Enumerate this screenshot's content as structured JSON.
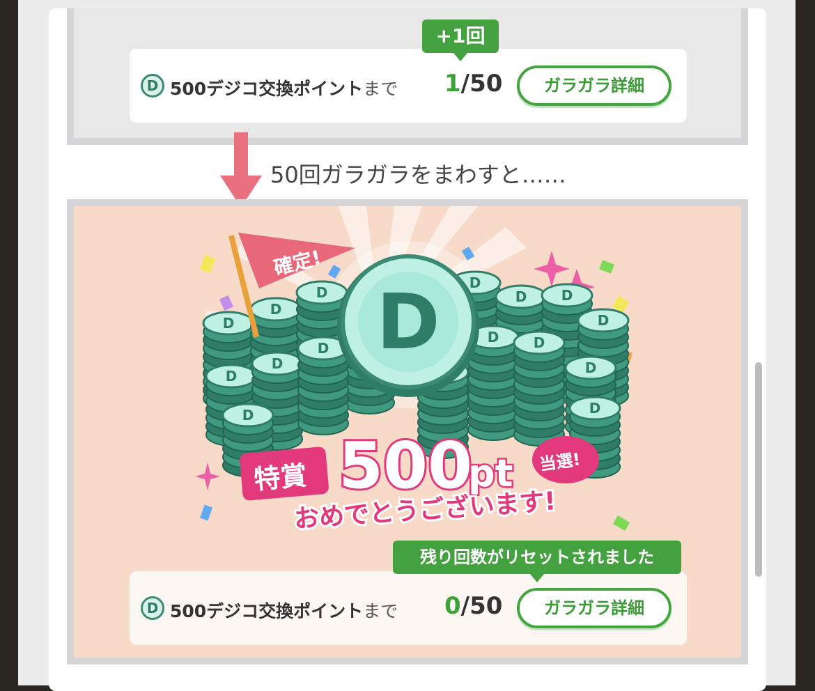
{
  "top_counter": {
    "balloon": "+1回",
    "coin_letter": "D",
    "label_main": "500デジコ交換ポイント",
    "label_suffix": "まで",
    "current": "1",
    "total": "/50",
    "button": "ガラガラ詳細"
  },
  "transition": {
    "caption": "50回ガラガラをまわすと……"
  },
  "prize": {
    "flag_text": "確定!",
    "coin_letter": "D",
    "award_label": "特賞",
    "amount": "500",
    "unit": "pt",
    "win_badge": "当選!",
    "congrats": "おめでとうございます!"
  },
  "bottom_counter": {
    "balloon": "残り回数がリセットされました",
    "coin_letter": "D",
    "label_main": "500デジコ交換ポイント",
    "label_suffix": "まで",
    "current": "0",
    "total": "/50",
    "button": "ガラガラ詳細"
  },
  "colors": {
    "accent_green": "#44a640",
    "arrow_pink": "#e8707f",
    "prize_bg": "#f7dac8",
    "coin_teal": "#3a8a74",
    "text_pink": "#e2397c"
  }
}
